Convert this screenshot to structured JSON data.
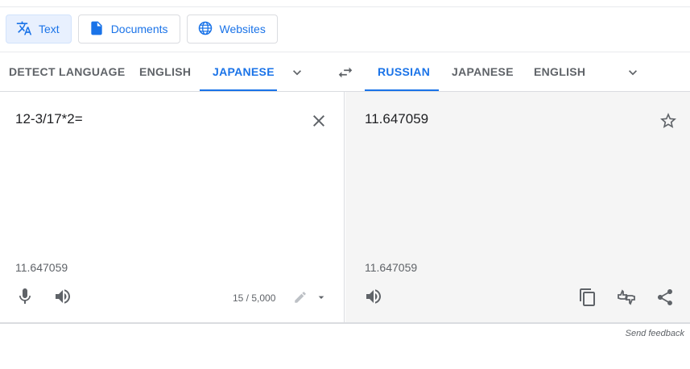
{
  "modes": [
    {
      "label": "Text",
      "icon": "translate-icon",
      "active": true
    },
    {
      "label": "Documents",
      "icon": "document-icon",
      "active": false
    },
    {
      "label": "Websites",
      "icon": "globe-icon",
      "active": false
    }
  ],
  "source_langs": [
    "DETECT LANGUAGE",
    "ENGLISH",
    "JAPANESE"
  ],
  "target_langs": [
    "RUSSIAN",
    "JAPANESE",
    "ENGLISH"
  ],
  "source": {
    "text": "12-3/17*2=",
    "transliteration": "11.647059",
    "char_count": "15 / 5,000"
  },
  "target": {
    "text": "11.647059",
    "transliteration": "11.647059"
  },
  "footer": {
    "feedback": "Send feedback"
  },
  "colors": {
    "accent": "#1a73e8",
    "icon": "#5f6368",
    "target_bg": "#f5f5f5"
  }
}
